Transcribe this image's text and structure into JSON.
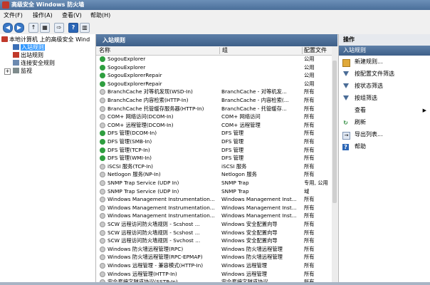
{
  "window": {
    "title": "高级安全 Windows 防火墙"
  },
  "menu": [
    "文件(F)",
    "操作(A)",
    "查看(V)",
    "帮助(H)"
  ],
  "tree": {
    "root": "本地计算机 上的高级安全 Wind",
    "items": [
      "入站规则",
      "出站规则",
      "连接安全规则",
      "监视"
    ]
  },
  "center": {
    "header": "入站规则",
    "columns": {
      "name": "名称",
      "group": "组",
      "profile": "配置文件"
    },
    "rows": [
      {
        "name": "SogouExplorer",
        "group": "",
        "profile": "公用",
        "enabled": true
      },
      {
        "name": "SogouExplorer",
        "group": "",
        "profile": "公用",
        "enabled": true
      },
      {
        "name": "SogouExplorerRepair",
        "group": "",
        "profile": "公用",
        "enabled": true
      },
      {
        "name": "SogouExplorerRepair",
        "group": "",
        "profile": "公用",
        "enabled": true
      },
      {
        "name": "BranchCache 对等机发现(WSD-In)",
        "group": "BranchCache - 对等机发...",
        "profile": "所有",
        "enabled": false
      },
      {
        "name": "BranchCache 内容检索(HTTP-In)",
        "group": "BranchCache - 内容检索(...",
        "profile": "所有",
        "enabled": false
      },
      {
        "name": "BranchCache 托管缓存服务器(HTTP-In)",
        "group": "BranchCache - 托管缓存...",
        "profile": "所有",
        "enabled": false
      },
      {
        "name": "COM+ 网络访问(DCOM-In)",
        "group": "COM+ 网络访问",
        "profile": "所有",
        "enabled": false
      },
      {
        "name": "COM+ 远程管理(DCOM-In)",
        "group": "COM+ 远程管理",
        "profile": "所有",
        "enabled": false
      },
      {
        "name": "DFS 管理(DCOM-In)",
        "group": "DFS 管理",
        "profile": "所有",
        "enabled": true
      },
      {
        "name": "DFS 管理(SMB-In)",
        "group": "DFS 管理",
        "profile": "所有",
        "enabled": true
      },
      {
        "name": "DFS 管理(TCP-In)",
        "group": "DFS 管理",
        "profile": "所有",
        "enabled": true
      },
      {
        "name": "DFS 管理(WMI-In)",
        "group": "DFS 管理",
        "profile": "所有",
        "enabled": true
      },
      {
        "name": "iSCSI 服务(TCP-In)",
        "group": "iSCSI 服务",
        "profile": "所有",
        "enabled": false
      },
      {
        "name": "Netlogon 服务(NP-In)",
        "group": "Netlogon 服务",
        "profile": "所有",
        "enabled": false
      },
      {
        "name": "SNMP Trap Service (UDP In)",
        "group": "SNMP Trap",
        "profile": "专用, 公用",
        "enabled": false
      },
      {
        "name": "SNMP Trap Service (UDP In)",
        "group": "SNMP Trap",
        "profile": "域",
        "enabled": false
      },
      {
        "name": "Windows Management Instrumentation...",
        "group": "Windows Management Inst...",
        "profile": "所有",
        "enabled": false
      },
      {
        "name": "Windows Management Instrumentation...",
        "group": "Windows Management Inst...",
        "profile": "所有",
        "enabled": false
      },
      {
        "name": "Windows Management Instrumentation...",
        "group": "Windows Management Inst...",
        "profile": "所有",
        "enabled": false
      },
      {
        "name": "SCW 远程访问防火墙规则 - Scshost ...",
        "group": "Windows 安全配置向导",
        "profile": "所有",
        "enabled": false
      },
      {
        "name": "SCW 远程访问防火墙规则 - Scshost ...",
        "group": "Windows 安全配置向导",
        "profile": "所有",
        "enabled": false
      },
      {
        "name": "SCW 远程访问防火墙规则 - Svchost ...",
        "group": "Windows 安全配置向导",
        "profile": "所有",
        "enabled": false
      },
      {
        "name": "Windows 防火墙远程管理(RPC)",
        "group": "Windows 防火墙远程管理",
        "profile": "所有",
        "enabled": false
      },
      {
        "name": "Windows 防火墙远程管理(RPC-EPMAP)",
        "group": "Windows 防火墙远程管理",
        "profile": "所有",
        "enabled": false
      },
      {
        "name": "Windows 远程管理 - 兼容模式(HTTP-In)",
        "group": "Windows 远程管理",
        "profile": "所有",
        "enabled": false
      },
      {
        "name": "Windows 远程管理(HTTP-In)",
        "group": "Windows 远程管理",
        "profile": "所有",
        "enabled": false
      },
      {
        "name": "安全套接字隧道协议(SSTP-In)",
        "group": "安全套接字隧道协议",
        "profile": "所有",
        "enabled": false
      }
    ]
  },
  "actions": {
    "header": "操作",
    "section": "入站规则",
    "items": [
      {
        "label": "新建规则...",
        "icon": "new-rule-icon"
      },
      {
        "label": "按配置文件筛选",
        "icon": "filter-icon"
      },
      {
        "label": "按状态筛选",
        "icon": "filter-icon"
      },
      {
        "label": "按组筛选",
        "icon": "filter-icon"
      },
      {
        "label": "查看",
        "icon": ""
      },
      {
        "label": "刷新",
        "icon": "refresh-icon"
      },
      {
        "label": "导出列表...",
        "icon": "export-icon"
      },
      {
        "label": "帮助",
        "icon": "help-icon"
      }
    ]
  }
}
